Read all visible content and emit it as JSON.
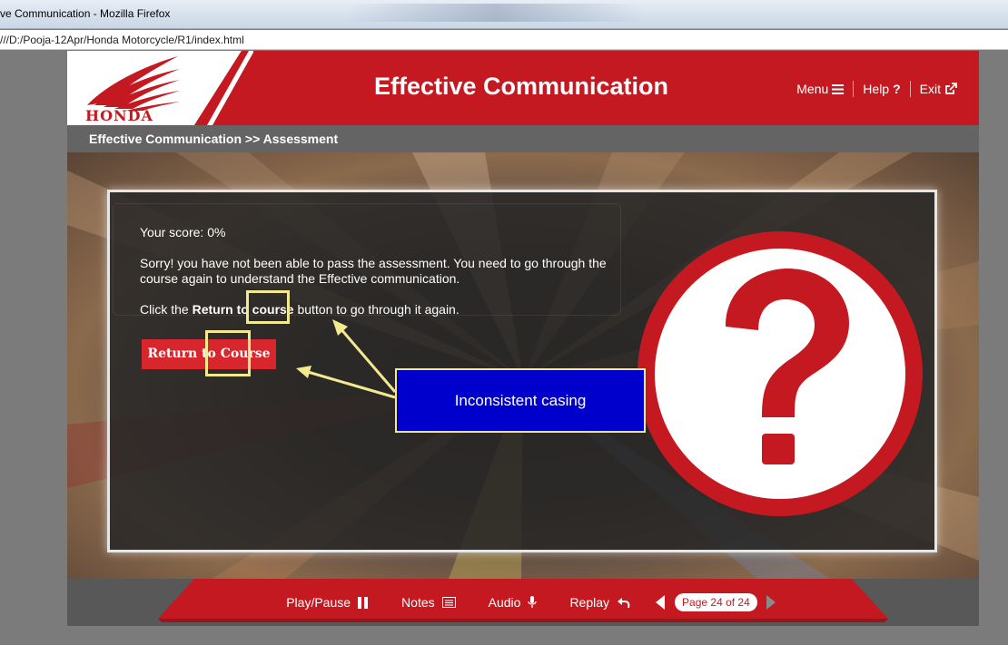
{
  "browser": {
    "window_title": "ve Communication - Mozilla Firefox",
    "url": "///D:/Pooja-12Apr/Honda Motorcycle/R1/index.html"
  },
  "header": {
    "logo_text": "HONDA",
    "title": "Effective Communication",
    "nav": [
      {
        "label": "Menu",
        "icon": "hamburger-icon"
      },
      {
        "label": "Help",
        "icon": "question-mark-icon"
      },
      {
        "label": "Exit",
        "icon": "external-link-icon"
      }
    ]
  },
  "breadcrumb": "Effective Communication >> Assessment",
  "result": {
    "score_text": "Your score: 0%",
    "message": "Sorry! you have not been able to pass the assessment. You need to go through the course again to understand the Effective communication.",
    "instruction_prefix": "Click the ",
    "instruction_bold": "Return to course",
    "instruction_suffix": " button to go through it again.",
    "button_label": "Return to Course"
  },
  "annotation": {
    "callout_text": "Inconsistent casing"
  },
  "footer": {
    "play_pause": "Play/Pause",
    "notes": "Notes",
    "audio": "Audio",
    "replay": "Replay",
    "page_label": "Page 24 of 24"
  },
  "colors": {
    "brand_red": "#c41920",
    "button_red": "#d8262d",
    "annotation_yellow": "#f3e98f",
    "callout_blue": "#0000cc"
  }
}
